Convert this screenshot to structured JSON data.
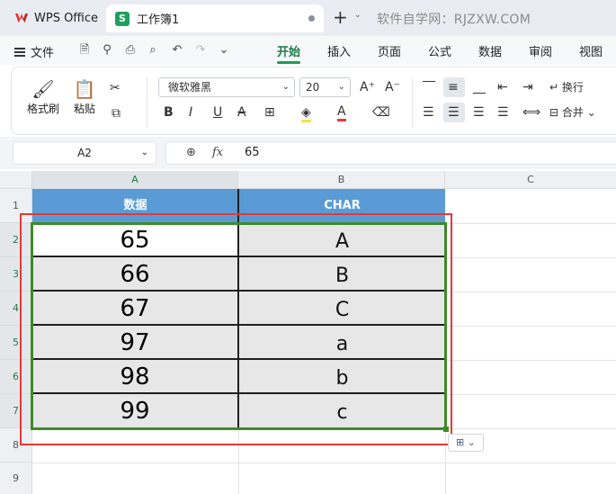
{
  "titlebar": {
    "app_name": "WPS Office",
    "doc_name": "工作簿1",
    "sheet_icon_letter": "S",
    "new_tab": "+",
    "watermark": "软件自学网：RJZXW.COM"
  },
  "menu": {
    "file": "文件",
    "tabs": [
      "开始",
      "插入",
      "页面",
      "公式",
      "数据",
      "审阅",
      "视图"
    ],
    "active_tab": "开始"
  },
  "ribbon": {
    "format_painter": "格式刷",
    "paste": "粘贴",
    "font_name": "微软雅黑",
    "font_size": "20",
    "wrap_text": "换行",
    "merge": "合并"
  },
  "formula_bar": {
    "cell_ref": "A2",
    "fx": "fx",
    "value": "65"
  },
  "columns": [
    "A",
    "B",
    "C"
  ],
  "rows": [
    "1",
    "2",
    "3",
    "4",
    "5",
    "6",
    "7",
    "8",
    "9"
  ],
  "table": {
    "headers": [
      "数据",
      "CHAR"
    ],
    "data": [
      [
        "65",
        "A"
      ],
      [
        "66",
        "B"
      ],
      [
        "67",
        "C"
      ],
      [
        "97",
        "a"
      ],
      [
        "98",
        "b"
      ],
      [
        "99",
        "c"
      ]
    ]
  },
  "colors": {
    "header_fill": "#5b9bd5",
    "selection_border": "#3e8a28",
    "annotation_border": "#e53935",
    "accent": "#1d9c57"
  }
}
